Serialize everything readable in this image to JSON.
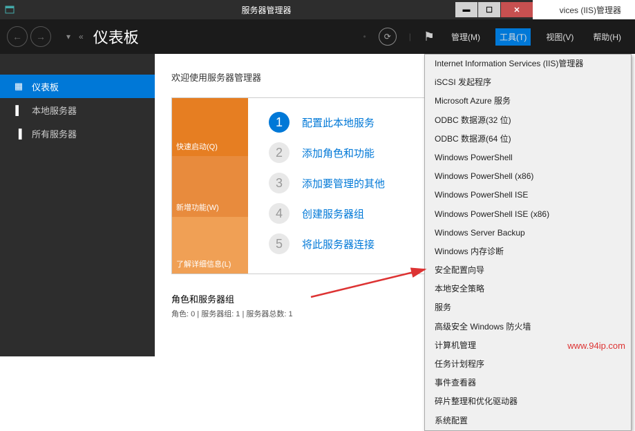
{
  "window": {
    "title": "服务器管理器",
    "controls": {
      "min": "▬",
      "max": "☐",
      "close": "✕"
    }
  },
  "background_partial_title": "vices (IIS)管理器",
  "topbar": {
    "breadcrumb_page": "仪表板",
    "menu": {
      "manage": "管理(M)",
      "tools": "工具(T)",
      "view": "视图(V)",
      "help": "帮助(H)"
    }
  },
  "sidebar": {
    "items": [
      {
        "label": "仪表板",
        "active": true
      },
      {
        "label": "本地服务器",
        "active": false
      },
      {
        "label": "所有服务器",
        "active": false
      }
    ]
  },
  "content": {
    "welcome": "欢迎使用服务器管理器",
    "tiles": {
      "quick": "快速启动(Q)",
      "new": "新增功能(W)",
      "learn": "了解详细信息(L)"
    },
    "steps": [
      {
        "num": "1",
        "text": "配置此本地服务"
      },
      {
        "num": "2",
        "text": "添加角色和功能"
      },
      {
        "num": "3",
        "text": "添加要管理的其他"
      },
      {
        "num": "4",
        "text": "创建服务器组"
      },
      {
        "num": "5",
        "text": "将此服务器连接"
      }
    ],
    "roles": {
      "title": "角色和服务器组",
      "caption": "角色: 0 | 服务器组: 1 | 服务器总数: 1"
    }
  },
  "tools_menu": {
    "items": [
      "Internet Information Services (IIS)管理器",
      "iSCSI 发起程序",
      "Microsoft Azure 服务",
      "ODBC 数据源(32 位)",
      "ODBC 数据源(64 位)",
      "Windows PowerShell",
      "Windows PowerShell (x86)",
      "Windows PowerShell ISE",
      "Windows PowerShell ISE (x86)",
      "Windows Server Backup",
      "Windows 内存诊断",
      "安全配置向导",
      "本地安全策略",
      "服务",
      "高级安全 Windows 防火墙",
      "计算机管理",
      "任务计划程序",
      "事件查看器",
      "碎片整理和优化驱动器",
      "系统配置"
    ]
  },
  "watermark": "www.94ip.com"
}
